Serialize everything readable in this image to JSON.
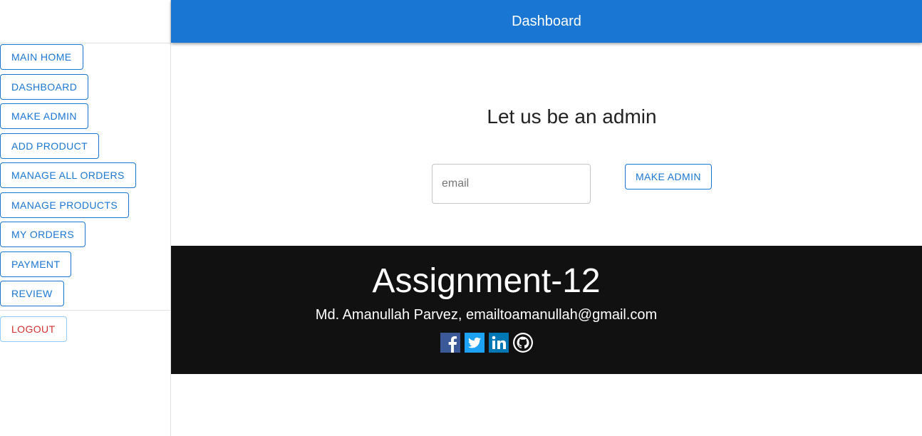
{
  "header": {
    "title": "Dashboard"
  },
  "sidebar": {
    "items": [
      {
        "label": "MAIN HOME"
      },
      {
        "label": "DASHBOARD"
      },
      {
        "label": "MAKE ADMIN"
      },
      {
        "label": "ADD PRODUCT"
      },
      {
        "label": "MANAGE ALL ORDERS"
      },
      {
        "label": "MANAGE PRODUCTS"
      },
      {
        "label": "MY ORDERS"
      },
      {
        "label": "PAYMENT"
      },
      {
        "label": "REVIEW"
      }
    ],
    "logout_label": "LOGOUT"
  },
  "main": {
    "heading": "Let us be an admin",
    "email_placeholder": "email",
    "email_value": "",
    "submit_label": "MAKE ADMIN"
  },
  "footer": {
    "title": "Assignment-12",
    "credit": "Md. Amanullah Parvez, emailtoamanullah@gmail.com",
    "social": [
      "facebook-icon",
      "twitter-icon",
      "linkedin-icon",
      "github-icon"
    ]
  },
  "colors": {
    "primary": "#1976d2",
    "logout": "#d32f2f",
    "footer_bg": "#111111",
    "facebook": "#3b5998",
    "twitter": "#1da1f2",
    "linkedin": "#0077b5"
  }
}
